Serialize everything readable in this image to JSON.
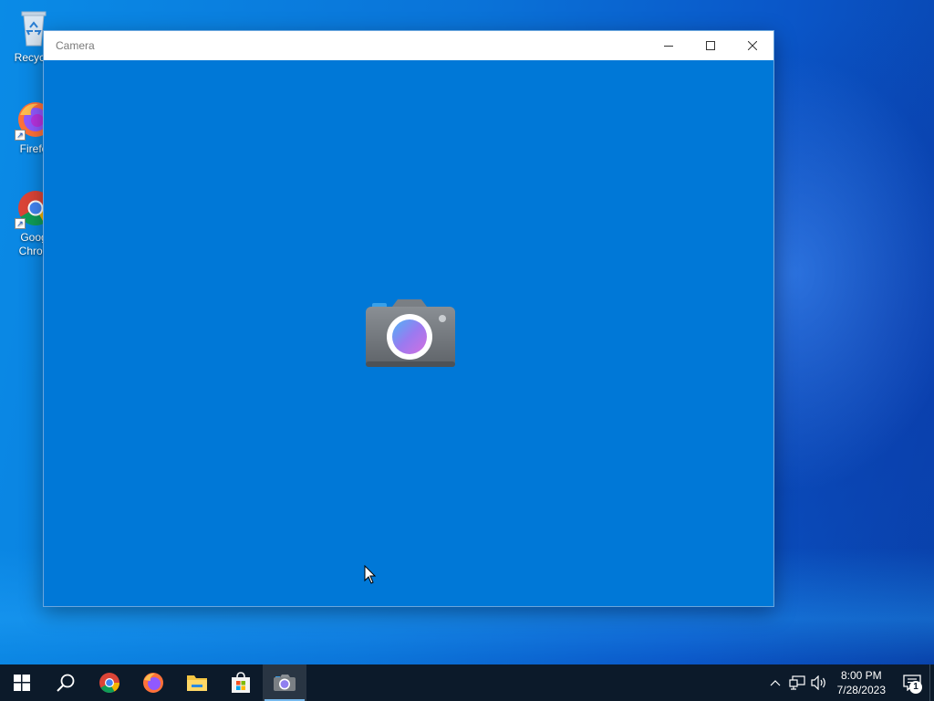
{
  "desktop": {
    "icons": [
      {
        "label": "Recycle",
        "icon": "recycle-bin-icon"
      },
      {
        "label": "Firefo",
        "icon": "firefox-icon"
      },
      {
        "label": "Goog\nChron",
        "line1": "Goog",
        "line2": "Chron",
        "icon": "chrome-icon"
      }
    ]
  },
  "window": {
    "title": "Camera",
    "controls": {
      "minimize": "minimize-icon",
      "maximize": "maximize-icon",
      "close": "close-icon"
    },
    "body_icon": "camera-app-icon",
    "background_color": "#0078d7"
  },
  "taskbar": {
    "buttons": [
      {
        "name": "start",
        "icon": "windows-start-icon"
      },
      {
        "name": "search",
        "icon": "search-icon"
      },
      {
        "name": "chrome",
        "icon": "chrome-icon"
      },
      {
        "name": "firefox",
        "icon": "firefox-icon"
      },
      {
        "name": "file-explorer",
        "icon": "folder-icon"
      },
      {
        "name": "store",
        "icon": "store-icon"
      },
      {
        "name": "camera",
        "icon": "camera-icon",
        "active": true
      }
    ],
    "tray": {
      "icons": [
        "chevron-up-icon",
        "network-icon",
        "volume-icon"
      ],
      "time": "8:00 PM",
      "date": "7/28/2023",
      "notification_count": "1"
    }
  },
  "colors": {
    "taskbar": "#0c1a2a",
    "window_body": "#0078d7",
    "accent_underline": "#76b9ed"
  }
}
